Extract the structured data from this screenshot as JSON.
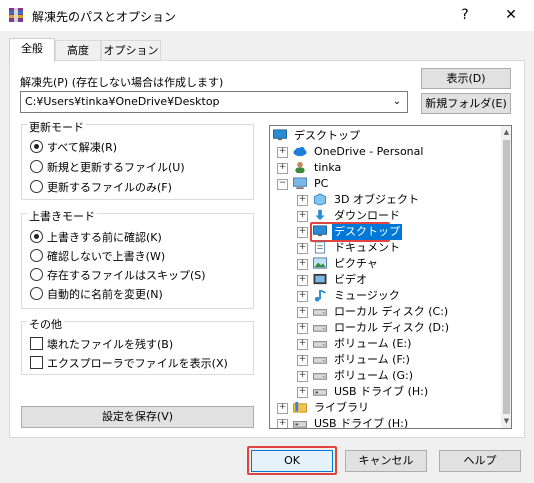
{
  "window": {
    "title": "解凍先のパスとオプション",
    "help": "?",
    "close": "✕"
  },
  "tabs": [
    "全般",
    "高度",
    "オプション"
  ],
  "dest": {
    "label": "解凍先(P) (存在しない場合は作成します)",
    "path": "C:¥Users¥tinka¥OneDrive¥Desktop"
  },
  "buttons": {
    "show": "表示(D)",
    "new_folder": "新規フォルダ(E)",
    "save_settings": "設定を保存(V)",
    "ok": "OK",
    "cancel": "キャンセル",
    "help": "ヘルプ"
  },
  "update_mode": {
    "title": "更新モード",
    "options": [
      "すべて解凍(R)",
      "新規と更新するファイル(U)",
      "更新するファイルのみ(F)"
    ],
    "selected": 0
  },
  "overwrite_mode": {
    "title": "上書きモード",
    "options": [
      "上書きする前に確認(K)",
      "確認しないで上書き(W)",
      "存在するファイルはスキップ(S)",
      "自動的に名前を変更(N)"
    ],
    "selected": 0
  },
  "misc": {
    "title": "その他",
    "options": [
      "壊れたファイルを残す(B)",
      "エクスプローラでファイルを表示(X)"
    ]
  },
  "tree": {
    "items": [
      {
        "label": "デスクトップ",
        "icon": "desktop-icon",
        "level": 0,
        "expander": ""
      },
      {
        "label": "OneDrive - Personal",
        "icon": "cloud-icon",
        "level": 1,
        "expander": "+"
      },
      {
        "label": "tinka",
        "icon": "user-icon",
        "level": 1,
        "expander": "+"
      },
      {
        "label": "PC",
        "icon": "pc-icon",
        "level": 1,
        "expander": "−"
      },
      {
        "label": "3D オブジェクト",
        "icon": "3d-objects-icon",
        "level": 2,
        "expander": "+"
      },
      {
        "label": "ダウンロード",
        "icon": "download-icon",
        "level": 2,
        "expander": "+"
      },
      {
        "label": "デスクトップ",
        "icon": "desktop-icon",
        "level": 2,
        "expander": "+",
        "selected": true
      },
      {
        "label": "ドキュメント",
        "icon": "documents-icon",
        "level": 2,
        "expander": "+"
      },
      {
        "label": "ピクチャ",
        "icon": "pictures-icon",
        "level": 2,
        "expander": "+"
      },
      {
        "label": "ビデオ",
        "icon": "video-icon",
        "level": 2,
        "expander": "+"
      },
      {
        "label": "ミュージック",
        "icon": "music-icon",
        "level": 2,
        "expander": "+"
      },
      {
        "label": "ローカル ディスク (C:)",
        "icon": "drive-icon",
        "level": 2,
        "expander": "+"
      },
      {
        "label": "ローカル ディスク (D:)",
        "icon": "drive-icon",
        "level": 2,
        "expander": "+"
      },
      {
        "label": "ボリューム (E:)",
        "icon": "drive-icon",
        "level": 2,
        "expander": "+"
      },
      {
        "label": "ボリューム (F:)",
        "icon": "drive-icon",
        "level": 2,
        "expander": "+"
      },
      {
        "label": "ボリューム (G:)",
        "icon": "drive-icon",
        "level": 2,
        "expander": "+"
      },
      {
        "label": "USB ドライブ (H:)",
        "icon": "usb-drive-icon",
        "level": 2,
        "expander": "+"
      },
      {
        "label": "ライブラリ",
        "icon": "library-icon",
        "level": 1,
        "expander": "+"
      },
      {
        "label": "USB ドライブ (H:)",
        "icon": "usb-drive-icon",
        "level": 1,
        "expander": "+"
      }
    ]
  },
  "colors": {
    "highlight": "#e0443e",
    "selection": "#0078d7"
  }
}
